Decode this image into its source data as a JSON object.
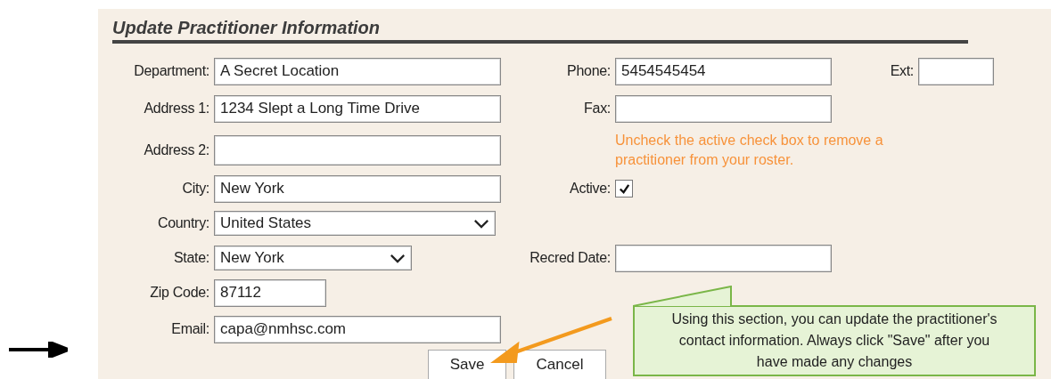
{
  "title": "Update Practitioner Information",
  "left_fields": [
    {
      "label": "Department:",
      "kind": "text",
      "value": "A Secret Location"
    },
    {
      "label": "Address 1:",
      "kind": "text",
      "value": "1234 Slept a Long Time Drive"
    },
    {
      "label": "Address 2:",
      "kind": "text"
    },
    {
      "label": "City:",
      "kind": "text",
      "value": "New York"
    },
    {
      "label": "Country:",
      "kind": "select",
      "value": "United States"
    },
    {
      "label": "State:",
      "kind": "select",
      "value": "New York"
    },
    {
      "label": "Zip Code:",
      "kind": "text",
      "value": "87112"
    },
    {
      "label": "Email:",
      "kind": "text",
      "value": "capa@nmhsc.com"
    }
  ],
  "phone": {
    "label": "Phone:",
    "value": "5454545454"
  },
  "ext": {
    "label": "Ext:"
  },
  "fax": {
    "label": "Fax:"
  },
  "note": "Uncheck the active check box to remove a practitioner from your roster.",
  "active": {
    "label": "Active:",
    "checked": true
  },
  "recred_date": {
    "label": "Recred Date:"
  },
  "buttons": [
    "Save",
    "Cancel"
  ],
  "callout": "Using this section, you can update the practitioner's contact information.  Always click \"Save\" after you have made any changes"
}
